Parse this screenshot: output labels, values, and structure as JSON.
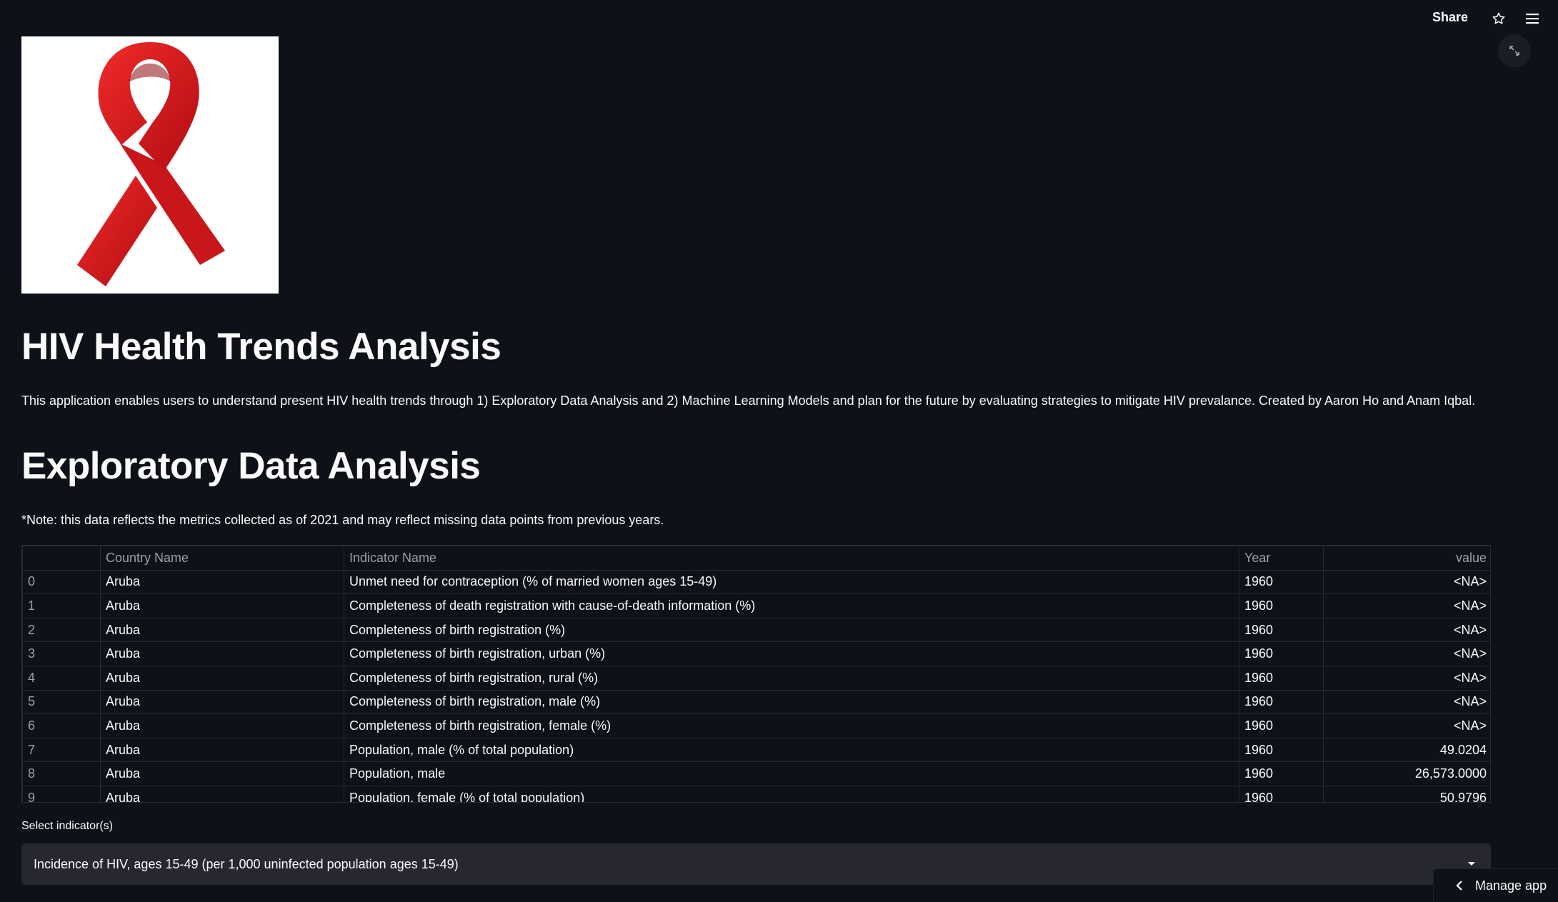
{
  "header": {
    "share_label": "Share",
    "star_icon": "star-icon",
    "menu_icon": "hamburger-menu-icon",
    "fullscreen_icon": "expand-icon"
  },
  "logo": {
    "icon": "red-ribbon-icon",
    "color": "#d0141b"
  },
  "main": {
    "title": "HIV Health Trends Analysis",
    "intro": "This application enables users to understand present HIV health trends through 1) Exploratory Data Analysis and 2) Machine Learning Models and plan for the future by evaluating strategies to mitigate HIV prevalance. Created by Aaron Ho and Anam Iqbal.",
    "section_title": "Exploratory Data Analysis",
    "note": "*Note: this data reflects the metrics collected as of 2021 and may reflect missing data points from previous years."
  },
  "table": {
    "columns": [
      "",
      "Country Name",
      "Indicator Name",
      "Year",
      "value"
    ],
    "rows": [
      [
        "0",
        "Aruba",
        "Unmet need for contraception (% of married women ages 15-49)",
        "1960",
        "<NA>"
      ],
      [
        "1",
        "Aruba",
        "Completeness of death registration with cause-of-death information (%)",
        "1960",
        "<NA>"
      ],
      [
        "2",
        "Aruba",
        "Completeness of birth registration (%)",
        "1960",
        "<NA>"
      ],
      [
        "3",
        "Aruba",
        "Completeness of birth registration, urban (%)",
        "1960",
        "<NA>"
      ],
      [
        "4",
        "Aruba",
        "Completeness of birth registration, rural (%)",
        "1960",
        "<NA>"
      ],
      [
        "5",
        "Aruba",
        "Completeness of birth registration, male (%)",
        "1960",
        "<NA>"
      ],
      [
        "6",
        "Aruba",
        "Completeness of birth registration, female (%)",
        "1960",
        "<NA>"
      ],
      [
        "7",
        "Aruba",
        "Population, male (% of total population)",
        "1960",
        "49.0204"
      ],
      [
        "8",
        "Aruba",
        "Population, male",
        "1960",
        "26,573.0000"
      ],
      [
        "9",
        "Aruba",
        "Population, female (% of total population)",
        "1960",
        "50.9796"
      ]
    ]
  },
  "indicator_select": {
    "label": "Select indicator(s)",
    "value": "Incidence of HIV, ages 15-49 (per 1,000 uninfected population ages 15-49)"
  },
  "manage_app": {
    "label": "Manage app",
    "icon": "chevron-left-icon"
  }
}
